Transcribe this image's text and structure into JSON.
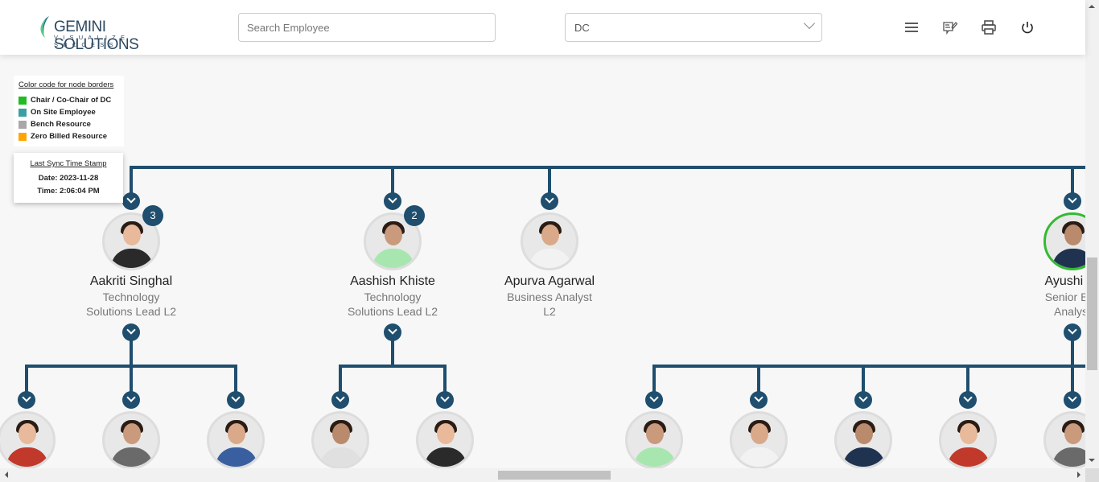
{
  "header": {
    "logo_title": "GEMINI SOLUTIONS",
    "logo_tagline": "VISUALIZE SUCCESS",
    "search_placeholder": "Search Employee",
    "dc_select": "DC",
    "icons": [
      "menu-icon",
      "feedback-edit-icon",
      "print-icon",
      "power-icon"
    ]
  },
  "legend": {
    "title": "Color code for node borders",
    "items": [
      {
        "label": "Chair / Co-Chair of DC",
        "color": "#22bb22"
      },
      {
        "label": "On Site Employee",
        "color": "#3a9fa5"
      },
      {
        "label": "Bench Resource",
        "color": "#a8a8a8"
      },
      {
        "label": "Zero Billed Resource",
        "color": "#ffa500"
      }
    ]
  },
  "sync": {
    "title": "Last Sync Time Stamp",
    "date": "Date: 2023-11-28",
    "time": "Time: 2:06:04 PM"
  },
  "nodes": [
    {
      "name": "Aakriti Singhal",
      "dept": "Technology",
      "title": "Solutions Lead L2",
      "count": "3",
      "border": "#dddddd"
    },
    {
      "name": "Aashish Khiste",
      "dept": "Technology",
      "title": "Solutions Lead L2",
      "count": "2",
      "border": "#dddddd"
    },
    {
      "name": "Apurva Agarwal",
      "dept": "Business Analyst",
      "title": "L2",
      "border": "#dddddd"
    },
    {
      "name": "Ayushi Ja",
      "dept": "Senior Bus",
      "title": "Analyst",
      "border": "#33bb33"
    }
  ],
  "colors": {
    "connector": "#1f4e6e"
  }
}
